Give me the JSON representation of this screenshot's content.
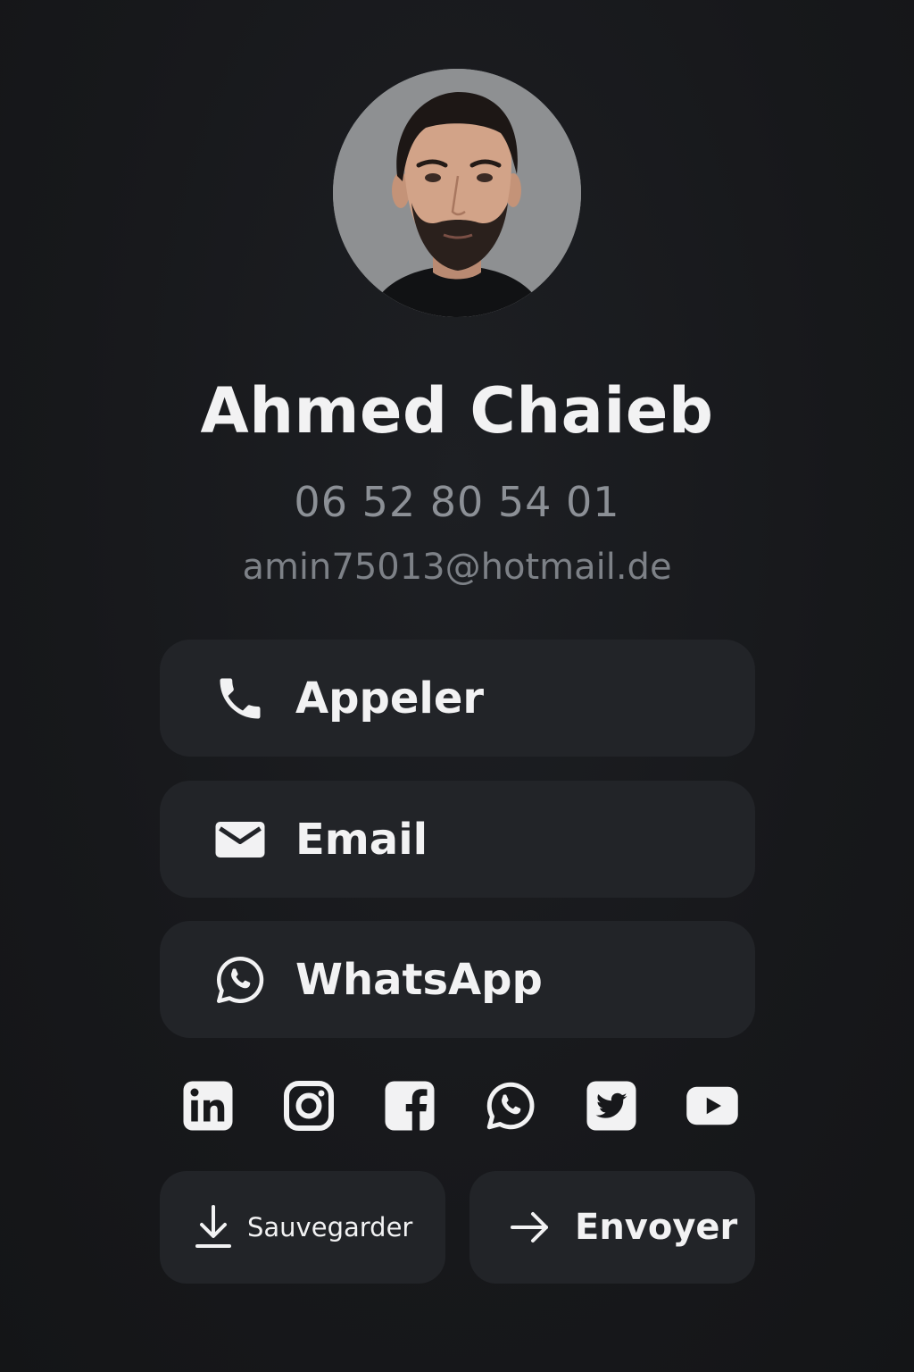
{
  "profile": {
    "name": "Ahmed Chaieb",
    "phone": "06 52 80 54 01",
    "email": "amin75013@hotmail.de",
    "avatar_icon": "person-portrait"
  },
  "actions": [
    {
      "label": "Appeler",
      "icon": "phone-icon"
    },
    {
      "label": "Email",
      "icon": "mail-icon"
    },
    {
      "label": "WhatsApp",
      "icon": "whatsapp-icon"
    }
  ],
  "socials": [
    {
      "icon": "linkedin-icon"
    },
    {
      "icon": "instagram-icon"
    },
    {
      "icon": "facebook-icon"
    },
    {
      "icon": "whatsapp-icon"
    },
    {
      "icon": "twitter-icon"
    },
    {
      "icon": "youtube-icon"
    }
  ],
  "footer": {
    "save_label": "Sauvegarder",
    "save_icon": "download-icon",
    "send_label": "Envoyer",
    "send_icon": "arrow-right-icon"
  },
  "colors": {
    "background": "#17181b",
    "button": "#222428",
    "text_primary": "#f2f2f3",
    "text_secondary": "#8c9096"
  }
}
